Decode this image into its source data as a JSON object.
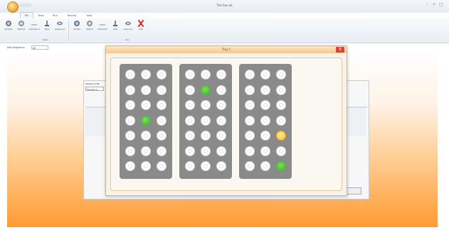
{
  "window": {
    "title": "The Sun ok",
    "min": "–",
    "max": "+",
    "close": "□"
  },
  "tabs": [
    {
      "label": "File",
      "active": true
    },
    {
      "label": "Tools"
    },
    {
      "label": "Run"
    },
    {
      "label": "Results"
    },
    {
      "label": "Help"
    }
  ],
  "ribbon": {
    "groups": [
      {
        "label": "Data",
        "buttons": [
          "Samples",
          "Methods",
          "Calibrations",
          "Tubes",
          "Sequences"
        ]
      },
      {
        "label": "Run",
        "buttons": [
          "Sample",
          "Method",
          "Calibration",
          "Tube",
          "Sequence",
          "Stop"
        ]
      }
    ]
  },
  "filter": {
    "label": "Net Sequence",
    "value": "All"
  },
  "background_panel": {
    "field_label": "Sequence Na",
    "field_value": "Sequence",
    "col_header": "Type"
  },
  "dialog": {
    "title": "Tray 1",
    "close_label": "X"
  },
  "trays": [
    {
      "rows": 7,
      "cols": 3,
      "green": [
        [
          3,
          1
        ]
      ],
      "yellow": []
    },
    {
      "rows": 7,
      "cols": 3,
      "green": [
        [
          1,
          1
        ]
      ],
      "yellow": []
    },
    {
      "rows": 7,
      "cols": 3,
      "green": [
        [
          6,
          2
        ]
      ],
      "yellow": [
        [
          4,
          2
        ]
      ]
    }
  ],
  "colors": {
    "accent": "#f2a93b",
    "workspace_bottom": "#ff9a33",
    "occupied": "#3caf2a",
    "pending": "#f2c335",
    "close": "#d9413a"
  }
}
